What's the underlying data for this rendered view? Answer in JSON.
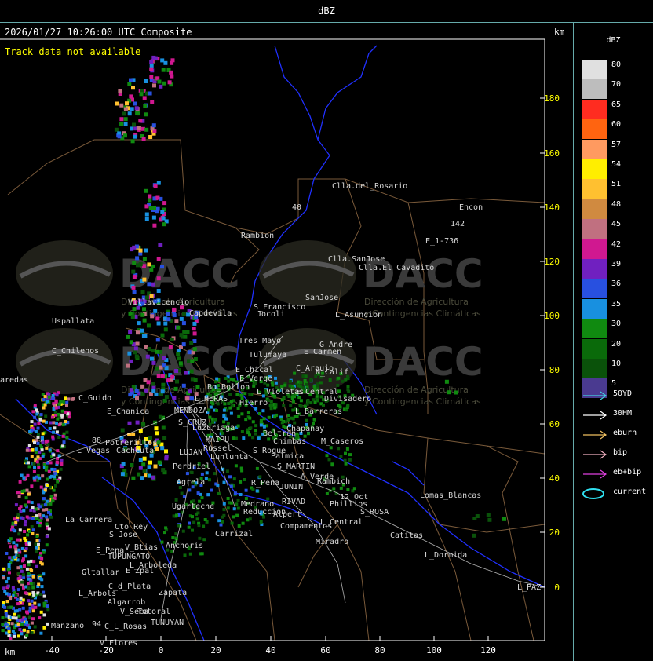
{
  "title": "dBZ",
  "header": {
    "timestamp": "2026/01/27 10:26:00 UTC Composite",
    "km_label": "km",
    "track_msg": "Track data not available"
  },
  "map": {
    "axis_unit": "km",
    "x_ticks": [
      "-40",
      "-20",
      "0",
      "20",
      "40",
      "60",
      "80",
      "100",
      "120"
    ],
    "y_ticks": [
      "180",
      "160",
      "140",
      "120",
      "100",
      "80",
      "60",
      "40",
      "20",
      "0"
    ],
    "watermark": {
      "brand": "DACC",
      "line1": "Dirección de Agricultura",
      "line2": "y Contingencias Climáticas"
    },
    "places": [
      "Clla.del_Rosario",
      "Encon",
      "142",
      "E_1-736",
      "Rambion",
      "40",
      "Clla.SanJose",
      "Clla.El_Cavadito",
      "Villavicencio",
      "S_Francisco",
      "SanJose",
      "Capdevila",
      "Jocoli",
      "L_Asuncion",
      "Uspallata",
      "Tres_Mayo",
      "Tulumaya",
      "G_Andre",
      "C_Chilenos",
      "E_Carmen",
      "C_Araujo",
      "N_Calif",
      "E_Chical",
      "E_Verge",
      "aredas",
      "Bo_Bollon",
      "L_Violetas",
      "E_Central",
      "Divisadero",
      "C_Guido",
      "L_HERAS",
      "Hierro",
      "L_Barreras",
      "E_Chanica",
      "MENDOZA",
      "S_CRUZ",
      "Chapanay",
      "Luzuriaga",
      "Beltran",
      "Chimbas",
      "M_Caseros",
      "88",
      "Potrerillos",
      "MAIPU",
      "Russel",
      "L_Vegas",
      "Cacheuta",
      "S_Roque",
      "LUJAN",
      "Lunlunta",
      "Palmica",
      "S_MARTIN",
      "Perdriel",
      "A_Verde",
      "Agrela",
      "Rambich",
      "R_Pena",
      "JUNIN",
      "Ugarteche",
      "Medrano",
      "RIVAD",
      "Phillips",
      "12_Oct",
      "Lomas_Blancas",
      "Reduccion",
      "Alpert",
      "S_ROSA",
      "La_Carrera",
      "Cto_Rey",
      "Compamentos",
      "L_Central",
      "S_Jose",
      "Carrizal",
      "Catitas",
      "Miradro",
      "V_Btias",
      "Anchoris",
      "E_Pena",
      "TUPUNGATO",
      "L_Dormida",
      "L_Arboleda",
      "Gltallar",
      "E_Zpal",
      "C_d_Plata",
      "L_PAZ",
      "L_Arbols",
      "Zapata",
      "Algarrob",
      "V_Seca",
      "Totoral",
      "Manzano",
      "TUNUYAN",
      "94",
      "C_L_Rosas",
      "V_Flores"
    ]
  },
  "legend": {
    "title": "dBZ",
    "scale": [
      {
        "label": "80",
        "color": "#e0e0e0"
      },
      {
        "label": "70",
        "color": "#bdbdbd"
      },
      {
        "label": "65",
        "color": "#ff2c20"
      },
      {
        "label": "60",
        "color": "#ff6410"
      },
      {
        "label": "57",
        "color": "#ff9a60"
      },
      {
        "label": "54",
        "color": "#ffee00"
      },
      {
        "label": "51",
        "color": "#ffc030"
      },
      {
        "label": "48",
        "color": "#d08a40"
      },
      {
        "label": "45",
        "color": "#c07080"
      },
      {
        "label": "42",
        "color": "#d01890"
      },
      {
        "label": "39",
        "color": "#7020c0"
      },
      {
        "label": "36",
        "color": "#2850e0"
      },
      {
        "label": "35",
        "color": "#1890e0"
      },
      {
        "label": "30",
        "color": "#108a10"
      },
      {
        "label": "20",
        "color": "#0a6a0a"
      },
      {
        "label": "10",
        "color": "#0a520a"
      },
      {
        "label": "5",
        "color": "#4a3a90"
      }
    ],
    "tracks": [
      {
        "label": "50YD",
        "color": "#40d0e0"
      },
      {
        "label": "30HM",
        "color": "#ffffff"
      },
      {
        "label": "eburn",
        "color": "#f0c060"
      },
      {
        "label": "bip",
        "color": "#f0b0c0"
      },
      {
        "label": "eb+bip",
        "color": "#e040e0"
      },
      {
        "label": "current",
        "color": "#30e0f0"
      }
    ]
  }
}
